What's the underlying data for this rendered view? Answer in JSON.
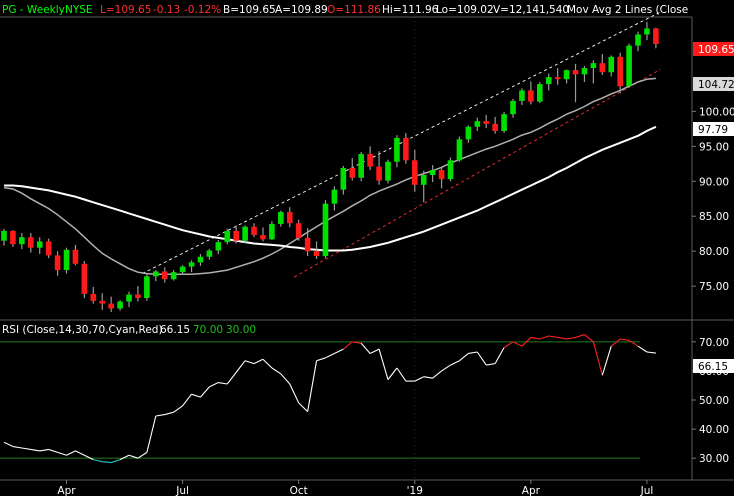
{
  "header": {
    "symbol": "PG - Weekly",
    "exchange": "NYSE",
    "last": "L=109.65",
    "change": "-0.13",
    "change_pct": "-0.12%",
    "bid": "B=109.65",
    "ask": "A=109.89",
    "open": "O=111.86",
    "high": "Hi=111.96",
    "low": "Lo=109.02",
    "volume": "V=12,141,540",
    "indicator": "Mov Avg 2 Lines (Close"
  },
  "rsi_header": {
    "title": "RSI (Close,14,30,70,Cyan,Red)",
    "value": "66.15",
    "upper": "70.00",
    "lower": "30.00"
  },
  "price_badges": {
    "last": "109.65",
    "ma_short": "104.72",
    "ma_long": "97.79"
  },
  "rsi_badge": "66.15",
  "colors": {
    "up": "#00e000",
    "down": "#ff1a1a",
    "neutral": "#9a9a9a",
    "ma_short": "#b0b0b0",
    "ma_long": "#ffffff",
    "rsi_line": "#ffffff",
    "rsi_cyan": "#22c8c8",
    "rsi_red": "#ff2020",
    "rsi_green_band": "#1f7a1f",
    "last_badge": "#ff1a1a"
  },
  "chart_data": [
    {
      "type": "candlestick",
      "title": "PG - Weekly",
      "y_ticks": [
        "75.00",
        "80.00",
        "85.00",
        "90.00",
        "95.00",
        "100.00"
      ],
      "x_ticks": [
        "Apr",
        "Jul",
        "Oct",
        "'19",
        "Apr",
        "Jul"
      ],
      "ylim": [
        70.3,
        113.5
      ],
      "series_ohlc": [
        [
          81.5,
          83.2,
          80.8,
          82.9
        ],
        [
          82.9,
          83.0,
          80.6,
          81.0
        ],
        [
          81.0,
          82.6,
          80.3,
          82.0
        ],
        [
          82.0,
          82.6,
          79.8,
          80.5
        ],
        [
          80.5,
          82.0,
          79.6,
          81.4
        ],
        [
          81.4,
          81.8,
          79.0,
          79.4
        ],
        [
          79.4,
          80.0,
          76.5,
          77.3
        ],
        [
          77.3,
          80.5,
          76.8,
          80.2
        ],
        [
          80.2,
          80.9,
          78.0,
          78.2
        ],
        [
          78.2,
          78.6,
          73.3,
          73.9
        ],
        [
          73.9,
          74.9,
          72.5,
          72.9
        ],
        [
          72.9,
          74.0,
          71.6,
          72.5
        ],
        [
          72.5,
          73.5,
          71.3,
          71.8
        ],
        [
          71.8,
          73.0,
          71.5,
          72.8
        ],
        [
          72.8,
          74.2,
          72.0,
          73.8
        ],
        [
          73.8,
          75.0,
          72.8,
          73.3
        ],
        [
          73.3,
          76.7,
          72.9,
          76.4
        ],
        [
          76.4,
          77.3,
          75.7,
          77.1
        ],
        [
          77.1,
          77.7,
          75.5,
          76.0
        ],
        [
          76.0,
          77.3,
          75.8,
          77.0
        ],
        [
          77.0,
          78.0,
          76.6,
          77.8
        ],
        [
          77.8,
          78.7,
          77.0,
          78.4
        ],
        [
          78.4,
          79.6,
          77.9,
          79.2
        ],
        [
          79.2,
          80.3,
          78.8,
          80.1
        ],
        [
          80.1,
          81.6,
          79.6,
          81.3
        ],
        [
          81.3,
          83.2,
          81.0,
          82.9
        ],
        [
          82.9,
          83.7,
          81.1,
          81.5
        ],
        [
          81.5,
          83.7,
          81.2,
          83.5
        ],
        [
          83.5,
          84.0,
          82.0,
          82.3
        ],
        [
          82.3,
          83.4,
          81.4,
          81.7
        ],
        [
          81.7,
          84.3,
          81.6,
          83.9
        ],
        [
          83.9,
          85.8,
          83.5,
          85.6
        ],
        [
          85.6,
          86.3,
          83.4,
          84.0
        ],
        [
          84.0,
          84.5,
          81.5,
          81.9
        ],
        [
          81.9,
          83.3,
          79.3,
          80.0
        ],
        [
          80.0,
          81.4,
          78.9,
          79.3
        ],
        [
          79.3,
          87.3,
          79.0,
          86.8
        ],
        [
          86.8,
          89.3,
          85.8,
          88.8
        ],
        [
          88.8,
          92.2,
          88.1,
          91.9
        ],
        [
          91.9,
          93.3,
          90.1,
          90.5
        ],
        [
          90.5,
          94.2,
          90.0,
          93.9
        ],
        [
          93.9,
          95.0,
          91.6,
          92.1
        ],
        [
          92.1,
          94.3,
          89.5,
          90.1
        ],
        [
          90.1,
          93.1,
          89.7,
          92.8
        ],
        [
          92.8,
          96.6,
          92.0,
          96.2
        ],
        [
          96.2,
          96.9,
          92.5,
          93.0
        ],
        [
          93.0,
          94.5,
          88.5,
          89.5
        ],
        [
          89.5,
          91.5,
          87.0,
          90.9
        ],
        [
          90.9,
          92.3,
          89.9,
          91.6
        ],
        [
          91.6,
          92.0,
          89.0,
          90.3
        ],
        [
          90.3,
          93.4,
          90.0,
          93.0
        ],
        [
          93.0,
          96.4,
          92.8,
          96.0
        ],
        [
          96.0,
          98.0,
          95.5,
          97.8
        ],
        [
          97.8,
          99.1,
          97.2,
          98.6
        ],
        [
          98.6,
          99.5,
          97.6,
          98.2
        ],
        [
          98.2,
          99.2,
          96.8,
          97.2
        ],
        [
          97.2,
          99.9,
          96.9,
          99.6
        ],
        [
          99.6,
          101.8,
          99.1,
          101.5
        ],
        [
          101.5,
          103.3,
          100.9,
          103.0
        ],
        [
          103.0,
          104.3,
          101.0,
          101.4
        ],
        [
          101.4,
          104.2,
          101.2,
          103.9
        ],
        [
          103.9,
          105.4,
          103.0,
          104.9
        ],
        [
          104.9,
          106.2,
          103.8,
          104.6
        ],
        [
          104.6,
          106.0,
          104.0,
          105.9
        ],
        [
          105.9,
          106.8,
          101.3,
          105.3
        ],
        [
          105.3,
          106.5,
          104.2,
          106.2
        ],
        [
          106.2,
          107.3,
          104.0,
          106.9
        ],
        [
          106.9,
          108.2,
          105.2,
          105.6
        ],
        [
          105.6,
          108.0,
          105.0,
          107.8
        ],
        [
          107.8,
          108.4,
          102.6,
          103.6
        ],
        [
          103.6,
          109.7,
          103.4,
          109.4
        ],
        [
          109.4,
          111.4,
          108.6,
          111.0
        ],
        [
          111.0,
          112.8,
          110.2,
          111.86
        ],
        [
          111.86,
          111.96,
          109.02,
          109.65
        ]
      ],
      "series": [
        {
          "name": "Mov Avg 2 Lines (Close",
          "role": "short",
          "values": [
            89.1,
            88.9,
            88.3,
            87.5,
            86.8,
            86.1,
            85.2,
            84.2,
            83.2,
            82.0,
            80.8,
            79.7,
            78.9,
            78.2,
            77.5,
            77.0,
            76.8,
            76.7,
            76.7,
            76.7,
            76.7,
            76.7,
            76.8,
            76.9,
            77.1,
            77.3,
            77.7,
            78.1,
            78.5,
            79.0,
            79.6,
            80.3,
            81.1,
            81.9,
            82.7,
            83.5,
            84.3,
            85.0,
            85.7,
            86.5,
            87.2,
            88.0,
            88.6,
            89.1,
            89.6,
            90.2,
            90.7,
            91.1,
            91.5,
            92.0,
            92.6,
            93.1,
            93.6,
            94.1,
            94.6,
            95.0,
            95.5,
            96.0,
            96.6,
            97.0,
            97.6,
            98.3,
            98.9,
            99.6,
            100.1,
            100.7,
            101.4,
            101.9,
            102.5,
            103.0,
            103.6,
            104.2,
            104.6,
            104.72
          ]
        },
        {
          "name": "",
          "role": "long",
          "values": [
            89.4,
            89.4,
            89.3,
            89.1,
            88.9,
            88.7,
            88.4,
            88.1,
            87.8,
            87.4,
            87.0,
            86.6,
            86.2,
            85.8,
            85.4,
            85.0,
            84.6,
            84.2,
            83.8,
            83.4,
            83.0,
            82.7,
            82.4,
            82.1,
            81.9,
            81.7,
            81.5,
            81.3,
            81.1,
            81.0,
            80.9,
            80.8,
            80.6,
            80.5,
            80.3,
            80.2,
            80.1,
            80.1,
            80.1,
            80.2,
            80.4,
            80.6,
            80.9,
            81.2,
            81.6,
            82.0,
            82.4,
            82.8,
            83.3,
            83.8,
            84.3,
            84.8,
            85.3,
            85.8,
            86.4,
            87.0,
            87.6,
            88.2,
            88.8,
            89.4,
            90.0,
            90.6,
            91.3,
            91.9,
            92.6,
            93.3,
            93.9,
            94.5,
            95.0,
            95.5,
            96.0,
            96.5,
            97.2,
            97.79
          ]
        }
      ],
      "trendlines": [
        {
          "style": "dashed",
          "color": "#ffffff",
          "from": [
            15.5,
            76.8
          ],
          "to": [
            73.5,
            114.2
          ]
        },
        {
          "style": "dashed",
          "color": "#ff3030",
          "from": [
            32.5,
            76.3
          ],
          "to": [
            73.5,
            106.0
          ]
        }
      ],
      "last_price": 109.65
    },
    {
      "type": "line",
      "title": "RSI (Close,14,30,70,Cyan,Red)",
      "y_ticks": [
        "30.00",
        "40.00",
        "50.00",
        "60.00",
        "70.00"
      ],
      "ylim": [
        22.5,
        77.5
      ],
      "levels": {
        "upper": 70,
        "lower": 30
      },
      "values": [
        35.5,
        34.0,
        33.5,
        33.0,
        32.5,
        33.0,
        32.0,
        31.0,
        32.5,
        31.0,
        29.5,
        28.8,
        28.5,
        29.5,
        31.0,
        30.0,
        32.0,
        44.5,
        45.0,
        45.8,
        48.0,
        52.0,
        51.0,
        54.5,
        56.0,
        55.5,
        59.5,
        63.5,
        62.5,
        64.0,
        61.0,
        59.0,
        55.5,
        49.0,
        46.0,
        63.5,
        64.5,
        66.0,
        67.5,
        70.0,
        69.5,
        66.0,
        67.5,
        57.0,
        61.0,
        56.5,
        56.5,
        58.0,
        57.5,
        60.0,
        62.0,
        63.5,
        66.0,
        66.5,
        62.0,
        62.5,
        68.0,
        70.0,
        68.5,
        71.5,
        71.0,
        72.0,
        71.5,
        71.0,
        71.5,
        72.5,
        70.0,
        58.5,
        68.5,
        71.0,
        70.5,
        68.5,
        66.5,
        66.15
      ]
    }
  ]
}
